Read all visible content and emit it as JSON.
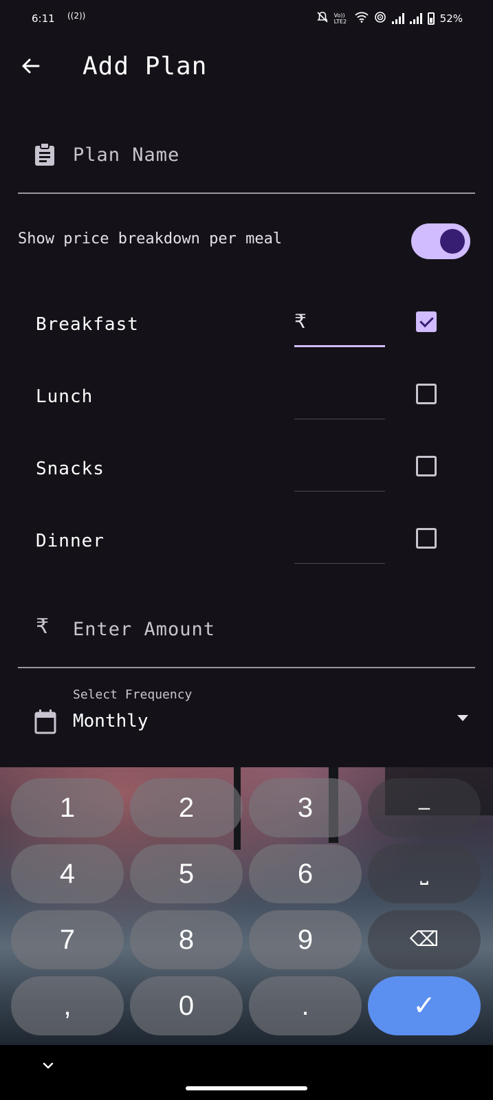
{
  "status_bar": {
    "time": "6:11",
    "hotspot": "((2))",
    "volte": "Vo)) LTE2",
    "battery_percent": "52%"
  },
  "app_bar": {
    "title": "Add Plan"
  },
  "plan_name": {
    "placeholder": "Plan Name"
  },
  "price_breakdown": {
    "label": "Show price breakdown per meal",
    "enabled": true
  },
  "meals": [
    {
      "label": "Breakfast",
      "prefix": "₹",
      "checked": true
    },
    {
      "label": "Lunch",
      "prefix": "",
      "checked": false
    },
    {
      "label": "Snacks",
      "prefix": "",
      "checked": false
    },
    {
      "label": "Dinner",
      "prefix": "",
      "checked": false
    }
  ],
  "amount": {
    "prefix": "₹",
    "placeholder": "Enter Amount"
  },
  "frequency": {
    "label": "Select Frequency",
    "value": "Monthly"
  },
  "keyboard": {
    "keys": [
      "1",
      "2",
      "3",
      "–",
      "4",
      "5",
      "6",
      "⎵",
      "7",
      "8",
      "9",
      "⌫",
      ",",
      "0",
      ".",
      "✓"
    ]
  },
  "colors": {
    "background": "#141218",
    "accent": "#d0bcff",
    "accent_dark": "#381e72",
    "enter_key": "#5b8ff0"
  }
}
